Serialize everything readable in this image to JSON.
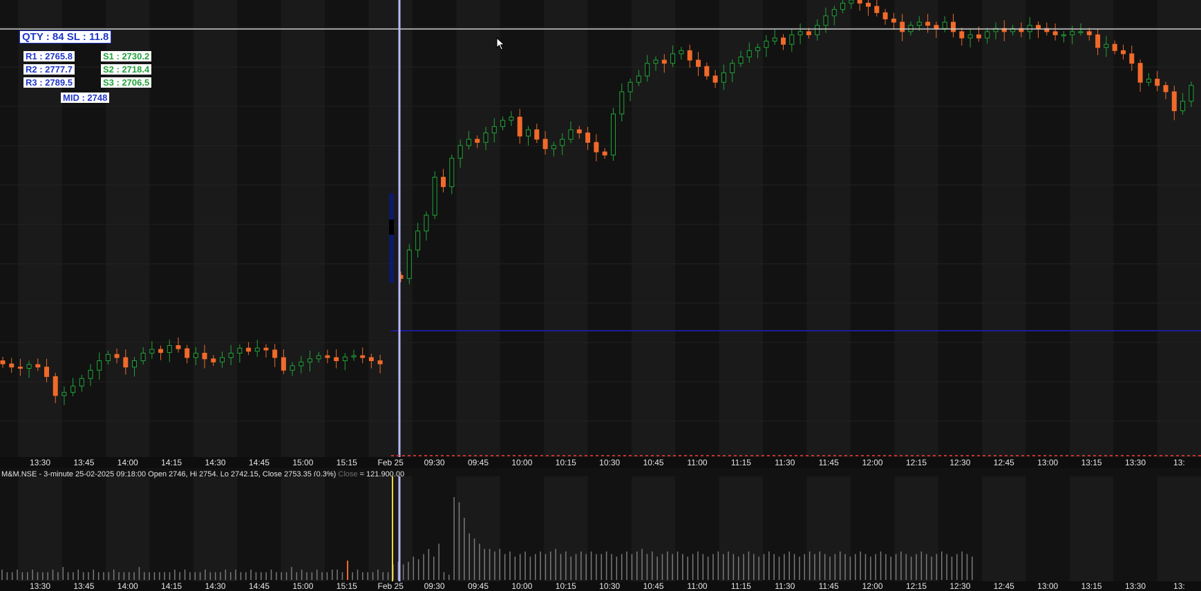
{
  "overlay": {
    "qty_sl": "QTY : 84   SL : 11.8",
    "r1": "R1 : 2765.8",
    "r2": "R2 : 2777.7",
    "r3": "R3 : 2789.5",
    "s1": "S1 : 2730.2",
    "s2": "S2 : 2718.4",
    "s3": "S3 : 2706.5",
    "mid": "MID : 2748"
  },
  "status": {
    "text": "M&M.NSE - 3-minute 25-02-2025 09:18:00 Open 2746, Hi 2754, Lo 2742.15, Close 2753.35 (0.3%)",
    "faded": "Close",
    "tail": " = 121,900.00"
  },
  "time_axis": [
    "13:30",
    "13:45",
    "14:00",
    "14:15",
    "14:30",
    "14:45",
    "15:00",
    "15:15",
    "Feb 25",
    "09:30",
    "09:45",
    "10:00",
    "10:15",
    "10:30",
    "10:45",
    "11:00",
    "11:15",
    "11:30",
    "11:45",
    "12:00",
    "12:15",
    "12:30",
    "12:45",
    "13:00",
    "13:15",
    "13:30",
    "13:"
  ],
  "colors": {
    "background": "#121212",
    "up": "#22a43a",
    "down": "#f06a2a",
    "cursor_line": "#b9b9ff",
    "entry_line": "#1d1d9a",
    "sl_line": "#d0d0d0",
    "volume": "#7a7a7a",
    "volume_highlight": "#f2d24a"
  },
  "chart_data": {
    "type": "candlestick",
    "symbol": "M&M.NSE",
    "interval": "3-minute",
    "x_ticks": [
      "13:30",
      "13:45",
      "14:00",
      "14:15",
      "14:30",
      "14:45",
      "15:00",
      "15:15",
      "Feb 25",
      "09:30",
      "09:45",
      "10:00",
      "10:15",
      "10:30",
      "10:45",
      "11:00",
      "11:15",
      "11:30",
      "11:45",
      "12:00",
      "12:15",
      "12:30",
      "12:45",
      "13:00",
      "13:15",
      "13:30",
      "13:"
    ],
    "levels": {
      "R1": 2765.8,
      "R2": 2777.7,
      "R3": 2789.5,
      "S1": 2730.2,
      "S2": 2718.4,
      "S3": 2706.5,
      "MID": 2748
    },
    "ylim": [
      2722,
      2794
    ],
    "prev_session_closes": [
      2736.5,
      2736.0,
      2735.8,
      2736.4,
      2736.0,
      2734.5,
      2731.5,
      2732.0,
      2733.0,
      2734.2,
      2735.5,
      2737.0,
      2738.0,
      2737.5,
      2736.0,
      2737.0,
      2738.2,
      2738.8,
      2738.3,
      2739.4,
      2738.9,
      2737.5,
      2738.2,
      2737.3,
      2736.8,
      2737.5,
      2738.2,
      2739.0,
      2738.5,
      2739.0,
      2738.7,
      2737.5,
      2735.5,
      2736.2,
      2736.8,
      2737.3,
      2737.8,
      2737.5,
      2737.0,
      2737.6,
      2737.8,
      2737.5,
      2737.0,
      2736.5
    ],
    "session_closes": [
      2750.0,
      2754.5,
      2757.5,
      2760.0,
      2766.0,
      2764.5,
      2769.0,
      2771.0,
      2772.0,
      2771.5,
      2773.0,
      2774.0,
      2775.0,
      2775.5,
      2772.5,
      2773.5,
      2772.0,
      2770.5,
      2771.0,
      2772.0,
      2773.5,
      2773.0,
      2771.5,
      2770.0,
      2769.5,
      2776.0,
      2779.5,
      2781.0,
      2782.0,
      2784.0,
      2784.5,
      2784.0,
      2785.5,
      2786.0,
      2784.5,
      2783.5,
      2782.0,
      2781.0,
      2782.5,
      2784.0,
      2785.0,
      2786.0,
      2786.5,
      2787.5,
      2788.0,
      2787.0,
      2788.5,
      2789.0,
      2788.5,
      2790.0,
      2791.5,
      2792.5,
      2793.5,
      2794.0,
      2793.5,
      2793.0,
      2792.0,
      2791.0,
      2790.5,
      2789.0,
      2790.0,
      2790.5,
      2790.0,
      2789.5,
      2790.5,
      2789.0,
      2788.0,
      2788.5,
      2788.0,
      2789.0,
      2789.5,
      2789.0,
      2789.5,
      2789.0,
      2790.0,
      2789.5,
      2789.0,
      2788.5,
      2788.5,
      2789.0,
      2789.0,
      2788.5,
      2786.5,
      2787.0,
      2786.0,
      2785.5,
      2784.0,
      2781.0,
      2781.5,
      2780.5,
      2779.5,
      2776.5,
      2778.0,
      2780.5
    ],
    "volume": [
      4,
      3,
      3,
      4,
      3,
      3,
      4,
      3,
      3,
      3,
      4,
      3,
      5,
      3,
      3,
      4,
      3,
      3,
      4,
      3,
      3,
      3,
      4,
      3,
      3,
      3,
      3,
      5,
      3,
      3,
      3,
      3,
      3,
      3,
      4,
      3,
      4,
      3,
      3,
      3,
      4,
      3,
      3,
      3,
      4,
      3,
      4,
      3,
      3,
      4,
      3,
      3,
      3,
      4,
      3,
      3,
      3,
      5,
      3,
      4,
      3,
      3,
      4,
      3,
      3,
      4,
      4,
      3,
      4,
      3,
      4,
      3,
      3,
      3,
      4,
      3,
      3,
      6,
      7,
      6,
      7,
      9,
      8,
      10,
      12,
      9,
      14,
      3,
      2,
      32,
      30,
      24,
      18,
      16,
      14,
      12,
      12,
      11,
      12,
      10,
      11,
      9,
      10,
      11,
      9,
      10,
      11,
      10,
      11,
      12,
      10,
      11,
      9,
      10,
      11,
      10,
      11,
      10,
      10,
      11,
      10,
      9,
      10,
      11,
      10,
      11,
      12,
      10,
      11,
      9,
      10,
      11,
      10,
      11,
      10,
      9,
      10,
      11,
      10,
      9,
      10,
      11,
      10,
      11,
      10,
      9,
      10,
      11,
      10,
      9,
      10,
      11,
      10,
      9,
      10,
      11,
      10,
      9,
      10,
      11,
      10,
      11,
      10,
      9,
      10,
      11,
      10,
      9,
      10,
      11,
      10,
      9,
      10,
      11,
      10,
      9,
      10,
      11,
      10,
      9,
      10,
      11,
      10,
      9,
      10,
      11,
      10,
      9,
      10,
      11,
      10,
      9
    ]
  }
}
